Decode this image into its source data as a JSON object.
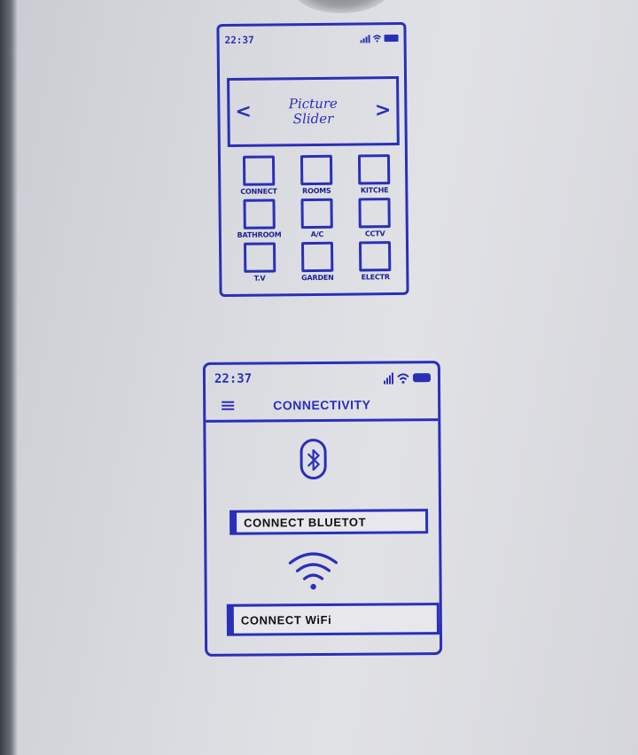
{
  "screens": {
    "home": {
      "status_time": "22:37",
      "slider_prev_glyph": "<",
      "slider_next_glyph": ">",
      "slider_label_line1": "Picture",
      "slider_label_line2": "Slider",
      "tiles": [
        {
          "label": "CONNECT",
          "icon": "empty-box-icon"
        },
        {
          "label": "ROOMS",
          "icon": "empty-box-icon"
        },
        {
          "label": "KITCHE",
          "icon": "empty-box-icon"
        },
        {
          "label": "BATHROOM",
          "icon": "empty-box-icon"
        },
        {
          "label": "A/C",
          "icon": "empty-box-icon"
        },
        {
          "label": "CCTV",
          "icon": "empty-box-icon"
        },
        {
          "label": "T.V",
          "icon": "empty-box-icon"
        },
        {
          "label": "GARDEN",
          "icon": "empty-box-icon"
        },
        {
          "label": "ELECTR",
          "icon": "empty-box-icon"
        }
      ]
    },
    "connectivity": {
      "status_time": "22:37",
      "title": "CONNECTIVITY",
      "bluetooth_button": "CONNECT BLUETOT",
      "wifi_button": "CONNECT WiFi"
    }
  },
  "colors": {
    "ink": "#2b2fb8",
    "paper": "#dcdde2"
  }
}
